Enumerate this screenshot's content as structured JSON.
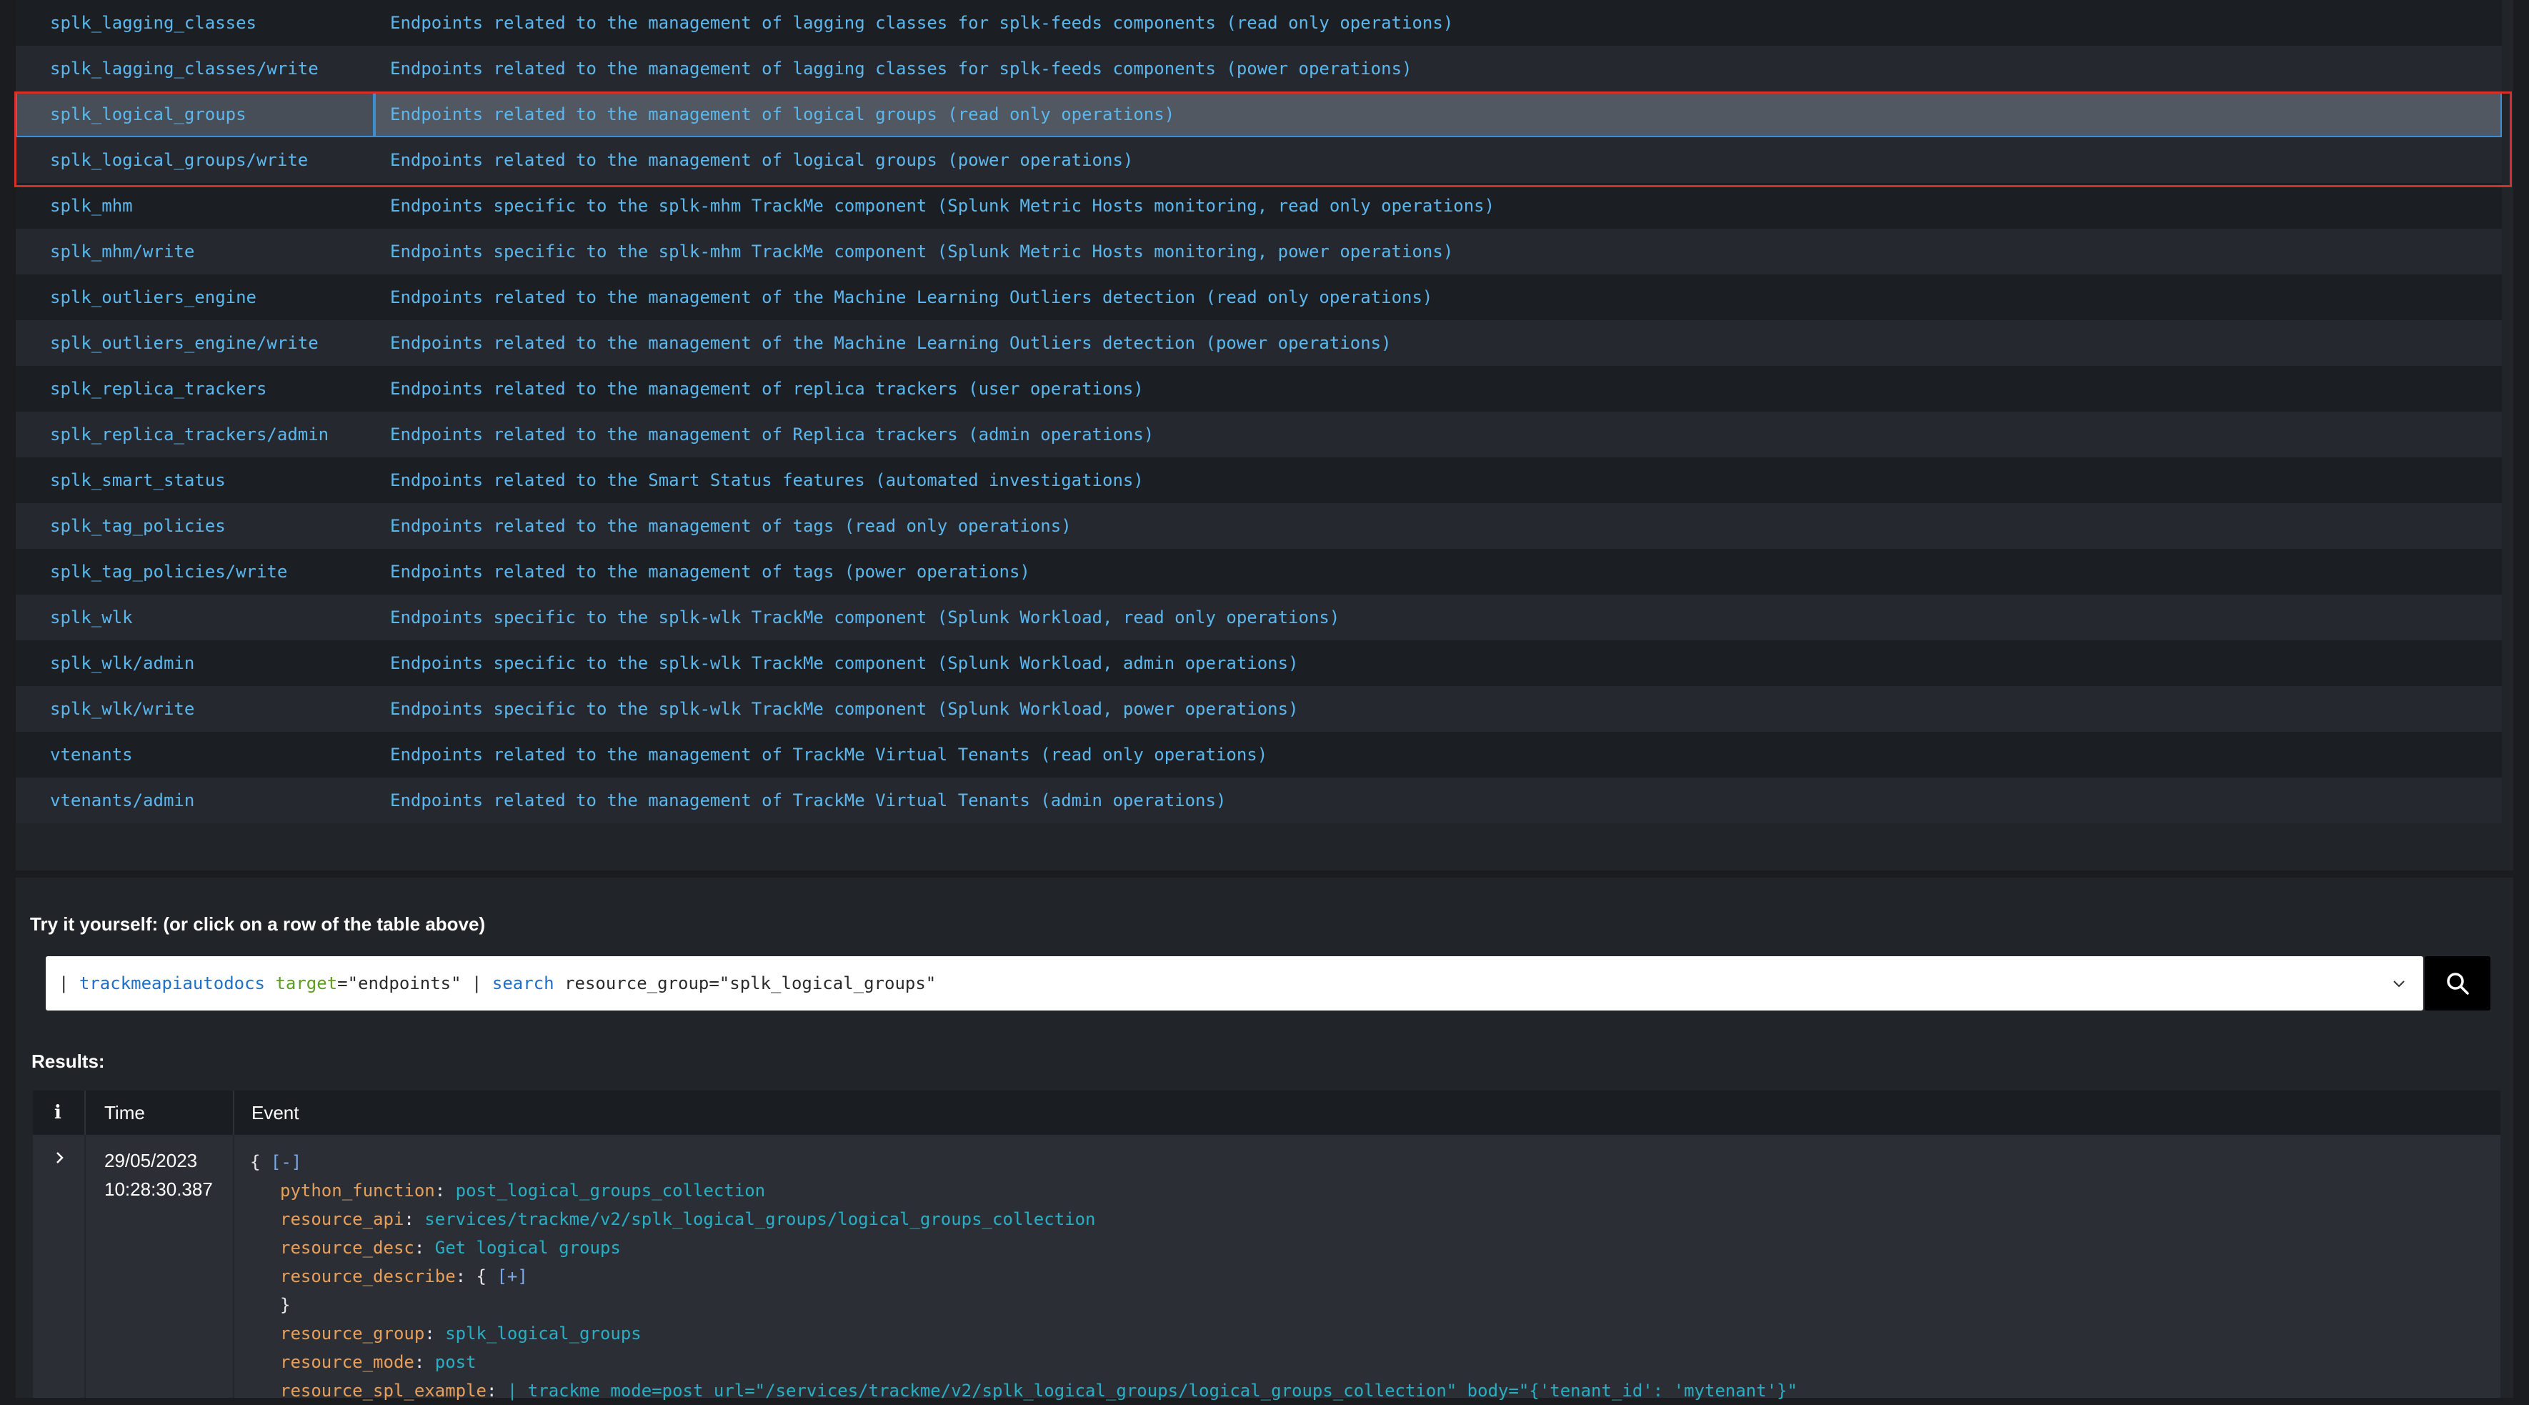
{
  "endpoints": [
    {
      "name": "splk_lagging_classes",
      "desc": "Endpoints related to the management of lagging classes for splk-feeds components (read only operations)"
    },
    {
      "name": "splk_lagging_classes/write",
      "desc": "Endpoints related to the management of lagging classes for splk-feeds components (power operations)"
    },
    {
      "name": "splk_logical_groups",
      "desc": "Endpoints related to the management of logical groups (read only operations)"
    },
    {
      "name": "splk_logical_groups/write",
      "desc": "Endpoints related to the management of logical groups (power operations)"
    },
    {
      "name": "splk_mhm",
      "desc": "Endpoints specific to the splk-mhm TrackMe component (Splunk Metric Hosts monitoring, read only operations)"
    },
    {
      "name": "splk_mhm/write",
      "desc": "Endpoints specific to the splk-mhm TrackMe component (Splunk Metric Hosts monitoring, power operations)"
    },
    {
      "name": "splk_outliers_engine",
      "desc": "Endpoints related to the management of the Machine Learning Outliers detection (read only operations)"
    },
    {
      "name": "splk_outliers_engine/write",
      "desc": "Endpoints related to the management of the Machine Learning Outliers detection (power operations)"
    },
    {
      "name": "splk_replica_trackers",
      "desc": "Endpoints related to the management of replica trackers (user operations)"
    },
    {
      "name": "splk_replica_trackers/admin",
      "desc": "Endpoints related to the management of Replica trackers (admin operations)"
    },
    {
      "name": "splk_smart_status",
      "desc": "Endpoints related to the Smart Status features (automated investigations)"
    },
    {
      "name": "splk_tag_policies",
      "desc": "Endpoints related to the management of tags (read only operations)"
    },
    {
      "name": "splk_tag_policies/write",
      "desc": "Endpoints related to the management of tags (power operations)"
    },
    {
      "name": "splk_wlk",
      "desc": "Endpoints specific to the splk-wlk TrackMe component (Splunk Workload, read only operations)"
    },
    {
      "name": "splk_wlk/admin",
      "desc": "Endpoints specific to the splk-wlk TrackMe component (Splunk Workload, admin operations)"
    },
    {
      "name": "splk_wlk/write",
      "desc": "Endpoints specific to the splk-wlk TrackMe component (Splunk Workload, power operations)"
    },
    {
      "name": "vtenants",
      "desc": "Endpoints related to the management of TrackMe Virtual Tenants (read only operations)"
    },
    {
      "name": "vtenants/admin",
      "desc": "Endpoints related to the management of TrackMe Virtual Tenants (admin operations)"
    }
  ],
  "selected_endpoint_index": 2,
  "try_label": "Try it yourself: (or click on a row of the table above)",
  "search": {
    "pipe": "|",
    "command": "trackmeapiautodocs",
    "arg_key": "target",
    "arg_value": "=\"endpoints\"",
    "pipe2": "|",
    "command2": "search",
    "filter": "resource_group=\"splk_logical_groups\""
  },
  "results_label": "Results:",
  "results_header": {
    "info": "i",
    "time": "Time",
    "event": "Event"
  },
  "result": {
    "date": "29/05/2023",
    "time": "10:28:30.387",
    "open_brace": "{",
    "collapse": "[-]",
    "python_function_key": "python_function",
    "python_function_value": "post_logical_groups_collection",
    "resource_api_key": "resource_api",
    "resource_api_value": "services/trackme/v2/splk_logical_groups/logical_groups_collection",
    "resource_desc_key": "resource_desc",
    "resource_desc_value": "Get logical groups",
    "resource_describe_key": "resource_describe",
    "resource_describe_open": "{",
    "resource_describe_expand": "[+]",
    "close_brace": "}",
    "resource_group_key": "resource_group",
    "resource_group_value": "splk_logical_groups",
    "resource_mode_key": "resource_mode",
    "resource_mode_value": "post",
    "resource_spl_example_key": "resource_spl_example",
    "resource_spl_example_value": "| trackme mode=post url=\"/services/trackme/v2/splk_logical_groups/logical_groups_collection\" body=\"{'tenant_id': 'mytenant'}\""
  },
  "colors": {
    "link": "#5bb7ee",
    "selection_border": "#3d8ed0",
    "annotation_box": "#d62f2b",
    "json_key": "#e7a05c",
    "json_value": "#2aaec4"
  }
}
